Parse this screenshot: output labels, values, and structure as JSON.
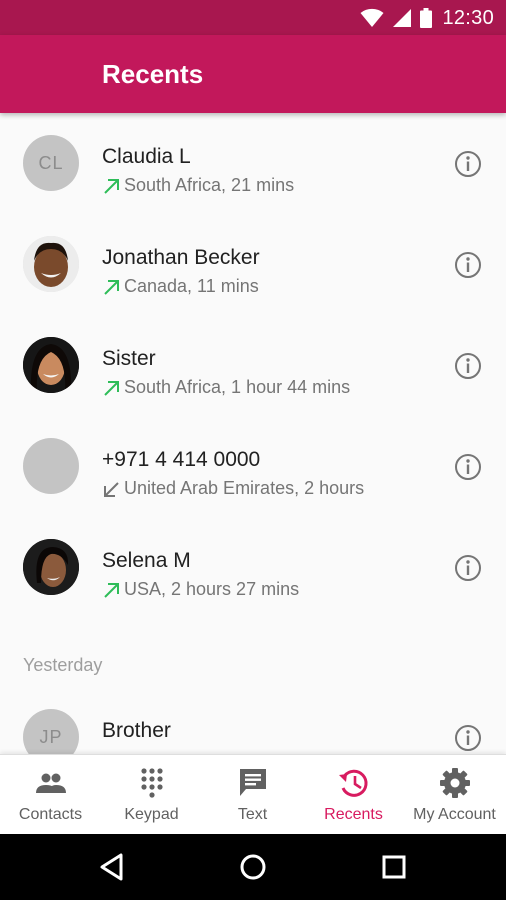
{
  "status_bar": {
    "time": "12:30",
    "icons": [
      "wifi-icon",
      "signal-icon",
      "battery-icon"
    ]
  },
  "app_bar": {
    "title": "Recents"
  },
  "recents": [
    {
      "name": "Claudia L",
      "initials": "CL",
      "avatar": "initials",
      "direction": "outgoing",
      "detail": "South Africa, 21 mins"
    },
    {
      "name": "Jonathan Becker",
      "initials": "",
      "avatar": "photo",
      "direction": "outgoing",
      "detail": "Canada, 11 mins"
    },
    {
      "name": "Sister",
      "initials": "",
      "avatar": "photo",
      "direction": "outgoing",
      "detail": "South Africa, 1 hour 44 mins"
    },
    {
      "name": "+971 4 414 0000",
      "initials": "",
      "avatar": "blank",
      "direction": "incoming",
      "detail": "United Arab Emirates, 2 hours"
    },
    {
      "name": "Selena M",
      "initials": "",
      "avatar": "photo",
      "direction": "outgoing",
      "detail": "USA, 2 hours 27 mins"
    }
  ],
  "sections": {
    "yesterday": "Yesterday"
  },
  "yesterday_recents": [
    {
      "name": "Brother",
      "initials": "JP",
      "avatar": "initials",
      "direction": "outgoing",
      "detail": ""
    }
  ],
  "bottom_nav": {
    "items": [
      {
        "label": "Contacts",
        "icon": "contacts-icon",
        "active": false
      },
      {
        "label": "Keypad",
        "icon": "keypad-icon",
        "active": false
      },
      {
        "label": "Text",
        "icon": "message-icon",
        "active": false
      },
      {
        "label": "Recents",
        "icon": "history-icon",
        "active": true
      },
      {
        "label": "My Account",
        "icon": "gear-icon",
        "active": false
      }
    ]
  },
  "system_nav": [
    "back-icon",
    "home-icon",
    "recent-apps-icon"
  ],
  "colors": {
    "status_bar": "#a8174f",
    "app_bar": "#c2185b",
    "accent": "#d81b60",
    "outgoing_arrow": "#2ebd59",
    "incoming_arrow": "#757575"
  }
}
